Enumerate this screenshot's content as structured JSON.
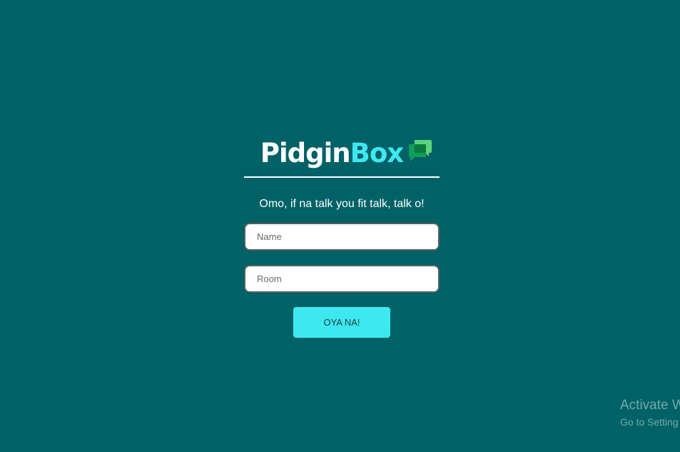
{
  "app": {
    "logo_part1": "Pidgin",
    "logo_part2": "Box",
    "logo_icon": "chat-bubbles-icon"
  },
  "form": {
    "tagline": "Omo, if na talk you fit talk, talk o!",
    "name_placeholder": "Name",
    "room_placeholder": "Room",
    "submit_label": "OYA NA!"
  },
  "watermark": {
    "title": "Activate W",
    "subtitle": "Go to Setting"
  },
  "colors": {
    "background": "#006266",
    "accent": "#3ee8f0",
    "icon_green": "#0f9d58"
  }
}
